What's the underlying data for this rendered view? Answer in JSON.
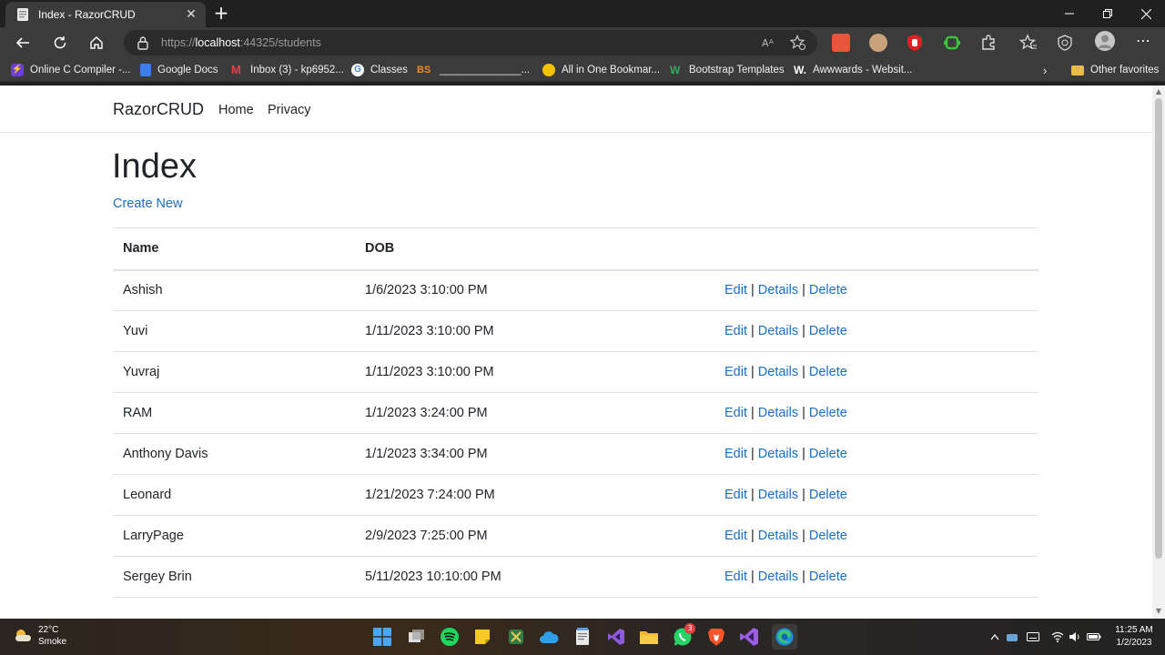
{
  "browser": {
    "tab_title": "Index - RazorCRUD",
    "tab_close": "✕",
    "new_tab": "+",
    "url_prefix": "https://",
    "url_host": "localhost",
    "url_rest": ":44325/students"
  },
  "bookmarks": [
    {
      "label": "Online C Compiler -...",
      "icon": "lightning-icon"
    },
    {
      "label": "Google Docs",
      "icon": "docs-icon"
    },
    {
      "label": "Inbox (3) - kp6952...",
      "icon": "gmail-icon"
    },
    {
      "label": "Classes",
      "icon": "google-icon"
    },
    {
      "label": "______________...",
      "icon": "bs-icon"
    },
    {
      "label": "All in One Bookmar...",
      "icon": "bookmark-icon"
    },
    {
      "label": "Bootstrap Templates",
      "icon": "w-icon"
    },
    {
      "label": "Awwwards - Websit...",
      "icon": "awwwards-icon"
    }
  ],
  "bookmarks_bs": "BS",
  "other_favorites": "Other favorites",
  "navbar": {
    "brand": "RazorCRUD",
    "links": [
      "Home",
      "Privacy"
    ]
  },
  "main": {
    "title": "Index",
    "create_link": "Create New",
    "table": {
      "headers": [
        "Name",
        "DOB",
        ""
      ],
      "rows": [
        {
          "name": "Ashish",
          "dob": "1/6/2023 3:10:00 PM"
        },
        {
          "name": "Yuvi",
          "dob": "1/11/2023 3:10:00 PM"
        },
        {
          "name": "Yuvraj",
          "dob": "1/11/2023 3:10:00 PM"
        },
        {
          "name": "RAM",
          "dob": "1/1/2023 3:24:00 PM"
        },
        {
          "name": "Anthony Davis",
          "dob": "1/1/2023 3:34:00 PM"
        },
        {
          "name": "Leonard",
          "dob": "1/21/2023 7:24:00 PM"
        },
        {
          "name": "LarryPage",
          "dob": "2/9/2023 7:25:00 PM"
        },
        {
          "name": "Sergey Brin",
          "dob": "5/11/2023 10:10:00 PM"
        }
      ],
      "actions": {
        "edit": "Edit",
        "details": "Details",
        "delete": "Delete",
        "separator": "|"
      }
    }
  },
  "taskbar": {
    "weather_temp": "22°C",
    "weather_desc": "Smoke",
    "whatsapp_badge": "3",
    "time": "11:25 AM",
    "date": "1/2/2023"
  },
  "colors": {
    "link": "#1b6ec2",
    "text": "#212529",
    "chrome_dark": "#202020",
    "chrome_toolbar": "#3b3b3b"
  }
}
